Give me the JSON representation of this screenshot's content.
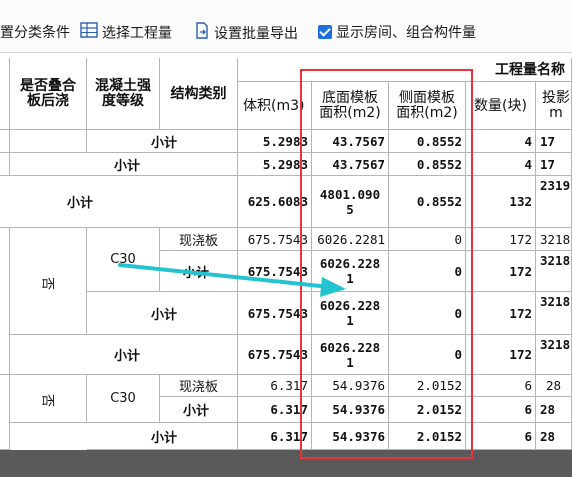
{
  "toolbar": {
    "item1": "置分类条件",
    "item2": "选择工程量",
    "item3": "设置批量导出",
    "item4": "显示房间、组合构件量"
  },
  "table": {
    "group_header": "工程量名称",
    "headers": {
      "col_a": "是否叠合\n板后浇",
      "col_b": "混凝土强\n度等级",
      "col_c": "结构类别",
      "volume": "体积(m3)",
      "bottom": "底面模板\n面积(m2)",
      "side": "侧面模板\n面积(m2)",
      "count": "数量(块)",
      "proj": "投影\nm"
    },
    "rows": [
      {
        "label": "小计",
        "volume": "5.2983",
        "bottom": "43.7567",
        "side": "0.8552",
        "count": "4",
        "proj": "17"
      },
      {
        "label": "小计",
        "volume": "5.2983",
        "bottom": "43.7567",
        "side": "0.8552",
        "count": "4",
        "proj": "17"
      },
      {
        "label": "小计",
        "volume": "625.6083",
        "bottom": "4801.090\n5",
        "side": "0.8552",
        "count": "132",
        "proj": "2319"
      },
      {
        "col_a": "否",
        "col_b": "C30",
        "col_c": "现浇板",
        "volume": "675.7543",
        "bottom": "6026.2281",
        "side": "0",
        "count": "172",
        "proj": "3218"
      },
      {
        "label": "小计",
        "volume": "675.7543",
        "bottom": "6026.228\n1",
        "side": "0",
        "count": "172",
        "proj": "3218"
      },
      {
        "label": "小计",
        "volume": "675.7543",
        "bottom": "6026.228\n1",
        "side": "0",
        "count": "172",
        "proj": "3218"
      },
      {
        "label": "小计",
        "volume": "675.7543",
        "bottom": "6026.228\n1",
        "side": "0",
        "count": "172",
        "proj": "3218"
      },
      {
        "col_a": "否",
        "col_b": "C30",
        "col_c": "现浇板",
        "volume": "6.317",
        "bottom": "54.9376",
        "side": "2.0152",
        "count": "6",
        "proj": "28"
      },
      {
        "label": "小计",
        "volume": "6.317",
        "bottom": "54.9376",
        "side": "2.0152",
        "count": "6",
        "proj": "28"
      },
      {
        "label": "小计",
        "volume": "6.317",
        "bottom": "54.9376",
        "side": "2.0152",
        "count": "6",
        "proj": "28"
      }
    ]
  },
  "colors": {
    "highlight_box": "#e8323c",
    "arrow": "#23c3cf",
    "checkbox": "#1e6fd9"
  }
}
